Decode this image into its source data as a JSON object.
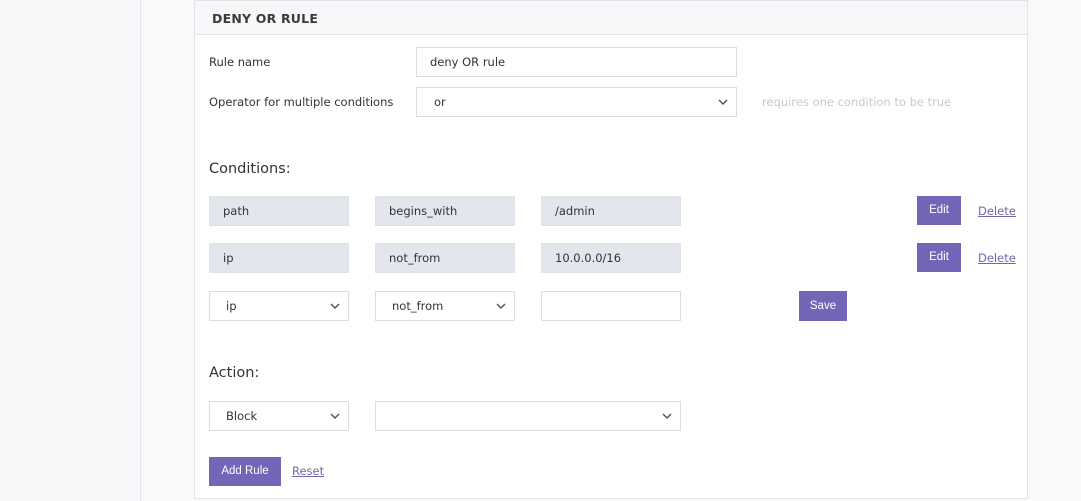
{
  "card": {
    "title": "DENY OR RULE"
  },
  "form": {
    "rule_name_label": "Rule name",
    "rule_name_value": "deny OR rule",
    "operator_label": "Operator for multiple conditions",
    "operator_value": "or",
    "operator_hint": "requires one condition to be true"
  },
  "conditions": {
    "title": "Conditions:",
    "rows": [
      {
        "field": "path",
        "operator": "begins_with",
        "value": "/admin",
        "edit_label": "Edit",
        "delete_label": "Delete"
      },
      {
        "field": "ip",
        "operator": "not_from",
        "value": "10.0.0.0/16",
        "edit_label": "Edit",
        "delete_label": "Delete"
      }
    ],
    "new_row": {
      "field": "ip",
      "operator": "not_from",
      "value": "",
      "save_label": "Save"
    }
  },
  "action": {
    "title": "Action:",
    "type_value": "Block",
    "secondary_value": ""
  },
  "footer": {
    "add_rule_label": "Add Rule",
    "reset_label": "Reset"
  },
  "colors": {
    "accent": "#7465b8",
    "chip_bg": "#e4e6ee",
    "hint_text": "#c7c9d1"
  }
}
